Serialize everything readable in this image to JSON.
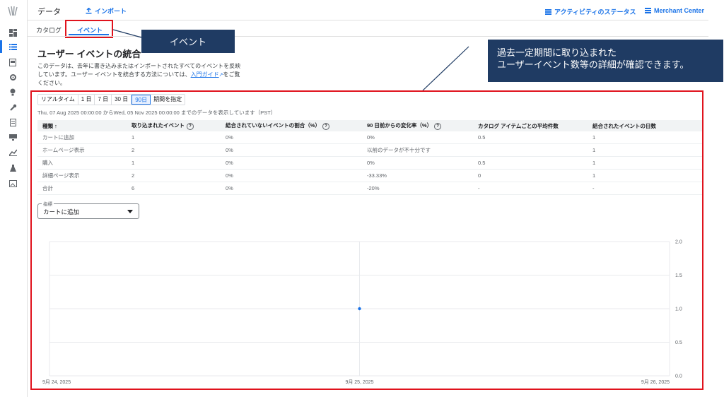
{
  "header": {
    "title": "データ",
    "import_label": "インポート",
    "activity_label": "アクティビティのステータス",
    "merchant_label": "Merchant Center"
  },
  "tabs": [
    {
      "label": "カタログ"
    },
    {
      "label": "イベント"
    }
  ],
  "section": {
    "title": "ユーザー イベントの統合",
    "desc_line1": "このデータは、去年に書き込みまたはインポートされたすべてのイベントを反映",
    "desc_line2a": "しています。ユーザー イベントを統合する方法については、",
    "guide_link": "入門ガイド",
    "desc_line2b": "をご覧",
    "desc_line3": "ください。"
  },
  "callouts": {
    "tab_callout": "イベント",
    "detail_line1": "過去一定期間に取り込まれた",
    "detail_line2": "ユーザーイベント数等の詳細が確認できます。"
  },
  "periods": [
    "リアルタイム",
    "1 日",
    "7 日",
    "30 日",
    "90日",
    "期間を指定"
  ],
  "date_range": "Thu, 07 Aug 2025 00:00:00 からWed, 05 Nov 2025 00:00:00 までのデータを表示しています（PST）",
  "table": {
    "headers": [
      "種類 ↑",
      "取り込まれたイベント",
      "結合されていないイベントの割合（%）",
      "90 日前からの変化率（%）",
      "カタログ アイテムごとの平均件数",
      "結合されたイベントの日数"
    ],
    "rows": [
      [
        "カートに追加",
        "1",
        "0%",
        "0%",
        "0.5",
        "1"
      ],
      [
        "ホームページ表示",
        "2",
        "0%",
        "以前のデータが不十分です",
        "",
        "1"
      ],
      [
        "購入",
        "1",
        "0%",
        "0%",
        "0.5",
        "1"
      ],
      [
        "詳細ページ表示",
        "2",
        "0%",
        "-33.33%",
        "0",
        "1"
      ],
      [
        "合計",
        "6",
        "0%",
        "-20%",
        "-",
        "-"
      ]
    ]
  },
  "metric": {
    "label": "指標",
    "value": "カートに追加"
  },
  "chart_data": {
    "type": "scatter",
    "x_ticks": [
      "9月 24, 2025",
      "9月 25, 2025",
      "9月 26, 2025"
    ],
    "y_ticks": [
      "0.0",
      "0.5",
      "1.0",
      "1.5",
      "2.0"
    ],
    "ylim": [
      0,
      2
    ],
    "series": [
      {
        "x": [
          "9月 25, 2025"
        ],
        "values": [
          1
        ],
        "color": "#1a73e8"
      }
    ]
  },
  "icons": [
    "logo-icon",
    "dashboard-icon",
    "list-icon",
    "catalog-icon",
    "settings-icon",
    "lightbulb-icon",
    "wrench-icon",
    "document-icon",
    "monitor-icon",
    "analytics-icon",
    "flask-icon",
    "image-icon"
  ]
}
